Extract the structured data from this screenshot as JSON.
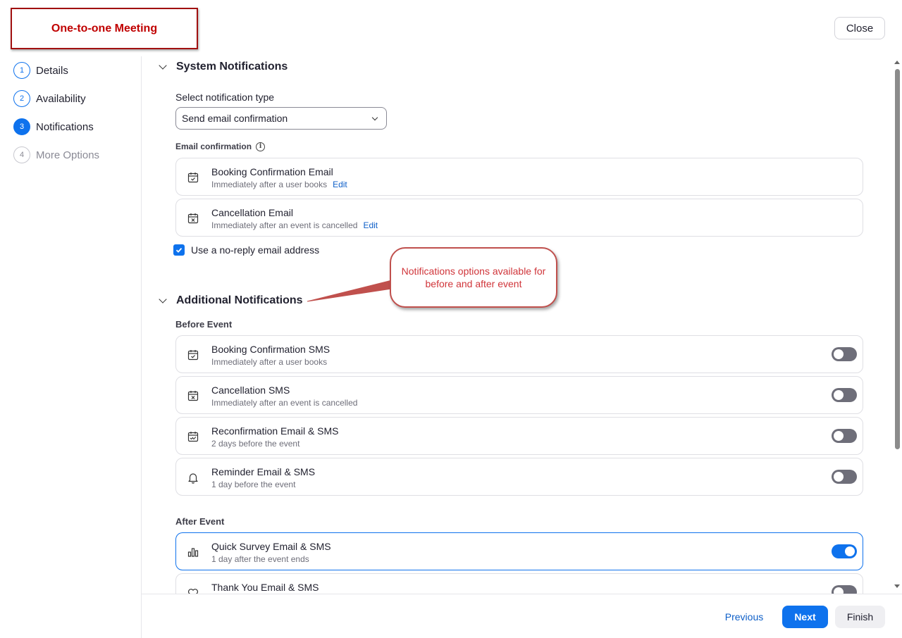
{
  "header": {
    "title": "One-to-one Meeting",
    "close_label": "Close"
  },
  "steps": [
    {
      "num": "1",
      "label": "Details"
    },
    {
      "num": "2",
      "label": "Availability"
    },
    {
      "num": "3",
      "label": "Notifications"
    },
    {
      "num": "4",
      "label": "More Options"
    }
  ],
  "system": {
    "title": "System Notifications",
    "select_label": "Select notification type",
    "select_value": "Send email confirmation",
    "email_label": "Email confirmation",
    "cards": [
      {
        "title": "Booking Confirmation Email",
        "sub": "Immediately after a user books",
        "edit": "Edit",
        "icon": "calendar-check-icon"
      },
      {
        "title": "Cancellation Email",
        "sub": "Immediately after an event is cancelled",
        "edit": "Edit",
        "icon": "calendar-x-icon"
      }
    ],
    "noreply_label": "Use a no-reply email address",
    "noreply_checked": true
  },
  "callout": "Notifications options available for before and after event",
  "additional": {
    "title": "Additional Notifications",
    "before_label": "Before Event",
    "before": [
      {
        "title": "Booking Confirmation SMS",
        "sub": "Immediately after a user books",
        "on": false,
        "icon": "calendar-check-icon"
      },
      {
        "title": "Cancellation SMS",
        "sub": "Immediately after an event is cancelled",
        "on": false,
        "icon": "calendar-x-icon"
      },
      {
        "title": "Reconfirmation Email & SMS",
        "sub": "2 days before the event",
        "on": false,
        "icon": "calendar-double-check-icon"
      },
      {
        "title": "Reminder Email & SMS",
        "sub": "1 day before the event",
        "on": false,
        "icon": "bell-icon"
      }
    ],
    "after_label": "After Event",
    "after": [
      {
        "title": "Quick Survey Email & SMS",
        "sub": "1 day after the event ends",
        "on": true,
        "icon": "bar-chart-icon"
      },
      {
        "title": "Thank You Email & SMS",
        "sub": "",
        "on": false,
        "icon": "heart-icon"
      }
    ]
  },
  "footer": {
    "previous": "Previous",
    "next": "Next",
    "finish": "Finish"
  },
  "colors": {
    "accent": "#0e72ed",
    "title_red": "#c00000",
    "callout_red": "#d0353a"
  }
}
